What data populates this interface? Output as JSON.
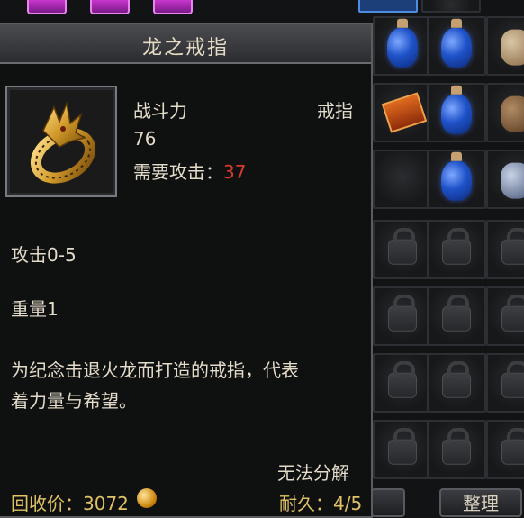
{
  "tooltip": {
    "title": "龙之戒指",
    "combat_power_label": "战斗力",
    "combat_power_value": "76",
    "item_type": "戒指",
    "requirement_label": "需要攻击：",
    "requirement_value": "37",
    "attack_stat": "攻击0-5",
    "weight_stat": "重量1",
    "description_line1": "为纪念击退火龙而打造的戒指，代表",
    "description_line2": "着力量与希望。",
    "cannot_decompose": "无法分解",
    "recycle_price_label": "回收价：",
    "recycle_price_value": "3072",
    "durability_label": "耐久：",
    "durability_value": "4/5"
  },
  "inventory": {
    "slot_status": "locked",
    "item_icons": [
      "ring-icon",
      "blue-potion-icon",
      "jar-icon",
      "spellbook-icon",
      "pink-gem-icon",
      "lock-icon"
    ],
    "sort_button_label": "整理"
  },
  "colors": {
    "panel_border": "#5a5c60",
    "text": "#e4dccb",
    "requirement_red": "#d83a2a",
    "coin_gold": "#e0a020"
  }
}
